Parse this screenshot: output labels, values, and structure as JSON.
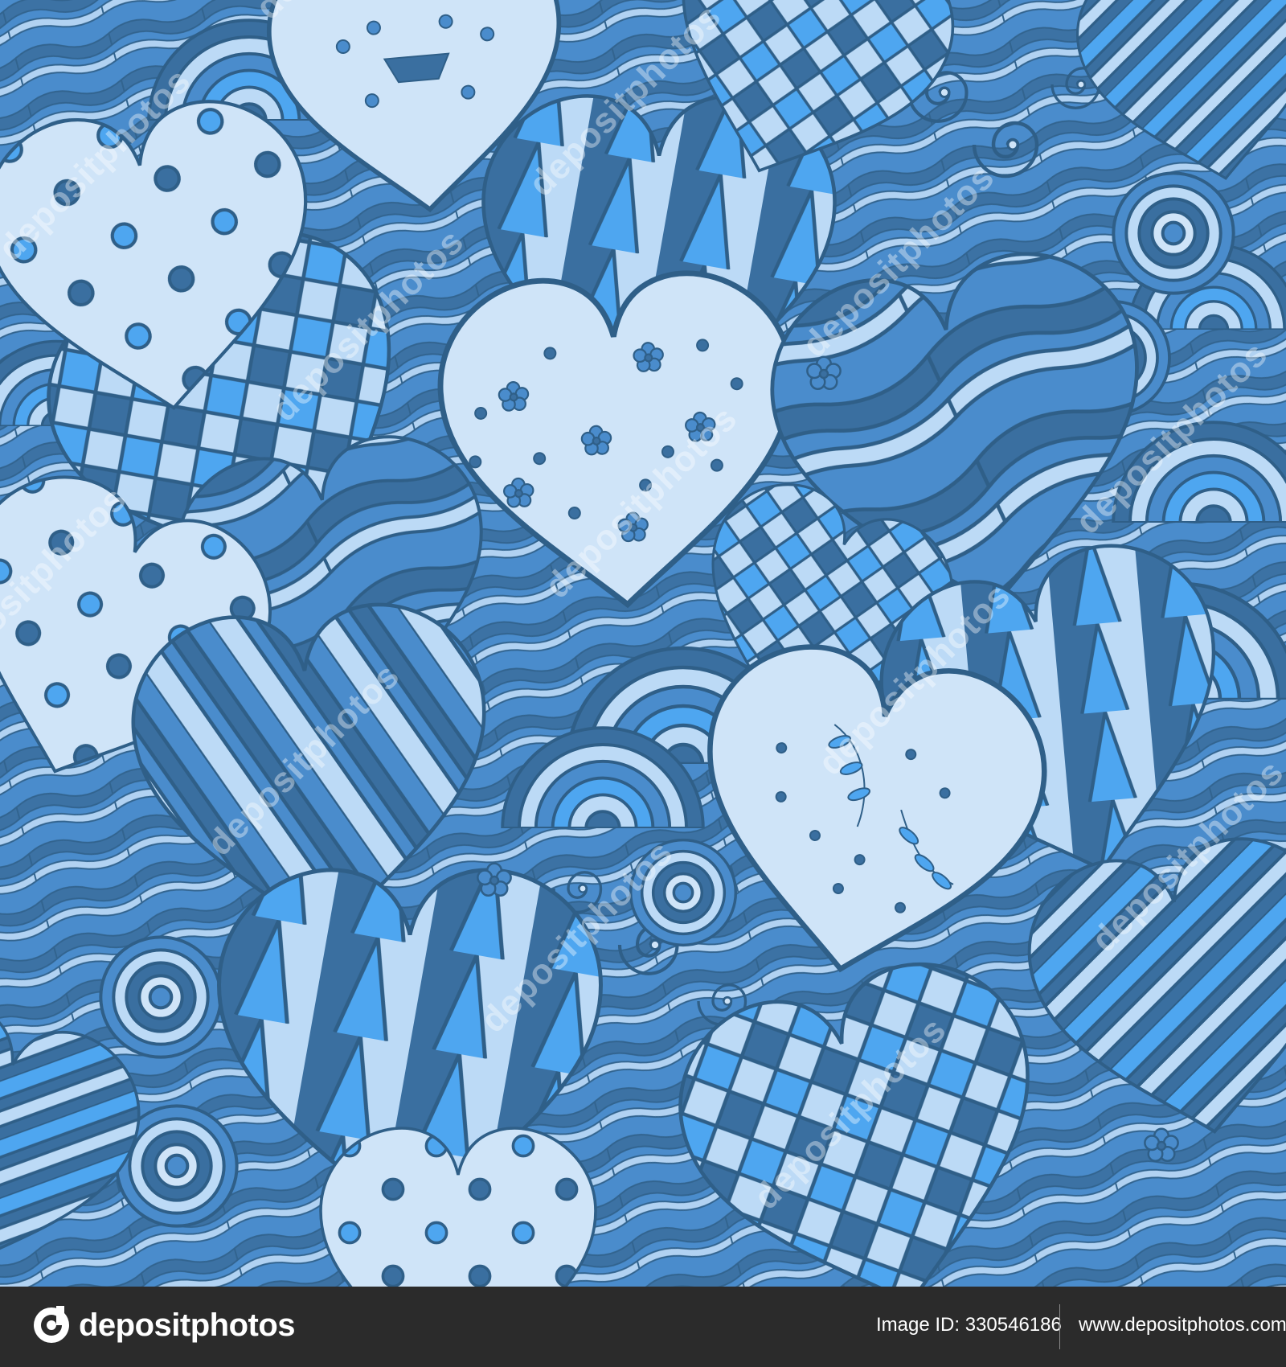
{
  "artwork": {
    "subject": "seamless blue doodle heart pattern",
    "colors": {
      "outline": "#2f5f88",
      "dark": "#3a6fa0",
      "mid": "#4a8ccc",
      "bright": "#4ea6f0",
      "light": "#bcdaf6",
      "pale": "#cfe4f8"
    }
  },
  "watermark": {
    "text": "depositphotos"
  },
  "footer": {
    "logo_text": "depositphotos",
    "image_id": "Image ID: 330546186",
    "site_url": "www.depositphotos.com"
  }
}
